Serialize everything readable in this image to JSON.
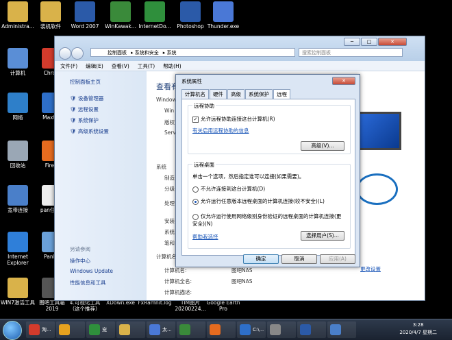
{
  "desktop": {
    "icons": [
      {
        "label": "Administra...",
        "color": "#d9b24a"
      },
      {
        "label": "装机软件",
        "color": "#d9b24a"
      },
      {
        "label": "Word 2007",
        "color": "#2b5aa8"
      },
      {
        "label": "WinKawak...",
        "color": "#3a8a3a"
      },
      {
        "label": "InternetDo...",
        "color": "#2f8f3c"
      },
      {
        "label": "Photoshop",
        "color": "#2b5aa8"
      },
      {
        "label": "Thunder.exe",
        "color": "#4a78d6"
      },
      {
        "label": "计算机",
        "color": "#5a8ed6"
      },
      {
        "label": "Chrom",
        "color": "#d33b2c"
      },
      {
        "label": "网络",
        "color": "#2e7fc9"
      },
      {
        "label": "Maxtho",
        "color": "#2e6fc9"
      },
      {
        "label": "回收站",
        "color": "#9aa7b5"
      },
      {
        "label": "Firefo",
        "color": "#e66b1f"
      },
      {
        "label": "宽带连接",
        "color": "#4a7fc9"
      },
      {
        "label": "pan任 txt",
        "color": "#eeeeee"
      },
      {
        "label": "Internet Explorer",
        "color": "#2f7fd9"
      },
      {
        "label": "PanDo",
        "color": "#6aa0d8"
      },
      {
        "label": "WIN7激活工具",
        "color": "#d9b24a"
      },
      {
        "label": "图吧工具箱 2019",
        "color": "#555555"
      },
      {
        "label": "4.可视化工具（这个推荐）",
        "color": "#d9b24a"
      },
      {
        "label": "XDown.exe",
        "color": "#2e6fc9"
      },
      {
        "label": "FxRamnit.log",
        "color": "#eeeeee"
      },
      {
        "label": "TIM图片 20200224...",
        "color": "#cfd8e6"
      },
      {
        "label": "Google Earth Pro",
        "color": "#4a8ad9"
      }
    ]
  },
  "explorer": {
    "caption_buttons": [
      "─",
      "□",
      "✕"
    ],
    "address": [
      "控制面板",
      "系统和安全",
      "系统"
    ],
    "search_placeholder": "搜索控制面板",
    "menu": [
      "文件(F)",
      "编辑(E)",
      "查看(V)",
      "工具(T)",
      "帮助(H)"
    ],
    "left_pane": {
      "home": "控制面板主页",
      "links": [
        "设备管理器",
        "远程设置",
        "系统保护",
        "高级系统设置"
      ],
      "see_also_title": "另请参阅",
      "see_also": [
        "操作中心",
        "Windows Update",
        "性能信息和工具"
      ]
    },
    "main_partial": {
      "heading": "查看有",
      "lines": [
        "Window",
        "Win",
        "版权",
        "Serv",
        "系统",
        "制造",
        "分级",
        "处理",
        "安装",
        "系统",
        "笔和",
        "计算机名",
        "计算机名:",
        "计算机全名:",
        "计算机描述:"
      ],
      "values": [
        "图吧NAS",
        "图吧NAS"
      ],
      "change_settings": "更改设置"
    }
  },
  "dialog": {
    "title": "系统属性",
    "close": "✕",
    "tabs": [
      "计算机名",
      "硬件",
      "高级",
      "系统保护",
      "远程"
    ],
    "assist": {
      "title": "远程协助",
      "checkbox_label": "允许远程协助连接这台计算机(R)",
      "checked": true,
      "link": "有关启用远程协助的信息",
      "advanced_button": "高级(V)..."
    },
    "desktop": {
      "title": "远程桌面",
      "instruction": "单击一个选项，然后指定谁可以连接(如果需要)。",
      "options": [
        {
          "label": "不允许连接到这台计算机(D)",
          "selected": false
        },
        {
          "label": "允许运行任意版本远程桌面的计算机连接(较不安全)(L)",
          "selected": true
        },
        {
          "label": "仅允许运行使用网络级别身份验证的远程桌面的计算机连接(更安全)(N)",
          "selected": false
        }
      ],
      "help_link": "帮助我选择",
      "select_users_button": "选择用户(S)..."
    },
    "buttons": {
      "ok": "确定",
      "cancel": "取消",
      "apply": "应用(A)"
    }
  },
  "taskbar": {
    "items": [
      "淘...",
      "",
      "宠",
      "",
      "太...",
      "",
      "",
      "C:\\...",
      "",
      "",
      ""
    ],
    "clock_time": "3:28",
    "clock_date": "2020/4/7 星期二"
  }
}
